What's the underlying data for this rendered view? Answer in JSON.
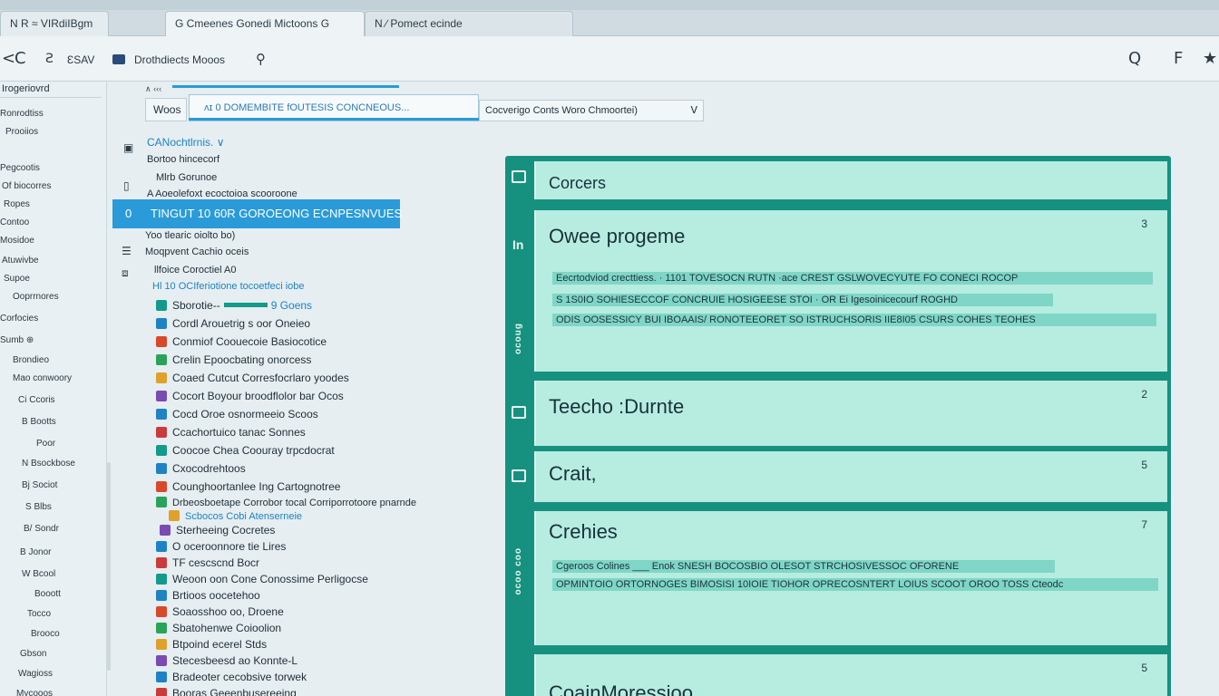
{
  "tabs": {
    "top_left": "N R  ≈  VIRdiIBgm",
    "tab1": "G   Cmeenes   Gonedi  Mictoons    G",
    "tab2": "N  ∕  Pomect ecinde"
  },
  "toolbar": {
    "back": "<",
    "reload": "C",
    "tools_label": "ƐSAV",
    "breadcrumb": "Drothdiects  Mooos",
    "search_icon": "Q",
    "f_icon": "F",
    "star_icon": "★"
  },
  "address": {
    "small_label": "∧ ‹‹‹",
    "word": "Woos",
    "input_value": "ᴧɪ 0 DOMEMBITE fOUTESIS CONCNEOUS...",
    "dropdown_value": "Cocverigo  Conts   Woro  Chmoortei)",
    "dropdown_chevron": "V"
  },
  "sidebar": {
    "top": "Irogeriovrd",
    "items": [
      "Ronrodtiss",
      "Prooiios",
      "Pegcootis",
      "Of biocorres",
      "Ropes",
      "Contoo",
      "Mosidoe",
      "Atuwivbe",
      "Supoe",
      "Ooprrnores",
      "Corfocies",
      "Sumb  ⊕",
      "Brondieo",
      "Mao conwoory",
      "Ci Ccoris",
      "B  Bootts",
      "Poor",
      "N  Bsockbose",
      "Bj  Sociot",
      "S  Blbs",
      "B/  Sondr",
      "B Jonor",
      "W  Bcool",
      "Booott",
      "Tocco",
      "Brooco",
      "Gbson",
      "Wagioss",
      "Mycooos"
    ]
  },
  "tree": {
    "header": "CANochtlrnis.   ∨",
    "rows": [
      "Bortoo hincecorf",
      "Mlrb Gorunoe",
      "A Aoeolefoxt ecoctoioa scooroone",
      "Yoo tlearic oiolto bo)",
      "Moqpvent Cachio oceis",
      "llfoice Coroctiel A0",
      "Hl 10  OCIferiotione tocoetfeci iobe",
      "Sborotie--",
      "Cordl  Arouetrig s oor Oneieo",
      "Conmiof Coouecoie Basiocotice",
      "Crelin Epoocbating onorcess",
      "Coaed Cutcut Corresfocrlaro yoodes",
      "Cocort Boyour broodflolor bar Ocos",
      "Cocd Oroe osnormeeio Scoos",
      "Ccachortuico tanac Sonnes",
      "Coocoe Chea Coouray trpcdocrat",
      "Cxocodrehtoos",
      "Counghoortanlee Ing Cartognotree",
      "Drbeosboetape Corrobor tocal Corriporrotoore pnarnde",
      "Scbocos Cobi Atenserneie",
      "Sterheeing Cocretes",
      "O oceroonnore tie Lires",
      "TF cescscnd Bocr",
      "Weoon oon Cone Conossime Perligocse",
      "Brtioos oocetehoo",
      "Soaosshoo oo, Droene",
      "Sbatohenwe Coioolion",
      "Btpoind ecerel Stds",
      "Stecesbeesd ao Konnte-L",
      "Bradeoter cecobsive torwek",
      "Booras Geeenbusereeing"
    ],
    "row_suffix_7": "9 Goens",
    "selected": "TINGUT  10  60R  GOROEONG  ECNPESNVUES",
    "selected_lead": "0"
  },
  "panel": {
    "rail_labels": [
      "ocoug",
      "ocoo coo"
    ],
    "cards": [
      {
        "title": "Corcers",
        "num": ""
      },
      {
        "title": "Owee progeme",
        "num": "3",
        "lines": [
          "Eecrtodviod  crecttiess.    ·   1101    TOVESOCN RUTN    ·ace   CREST GSLWOVECYUTE FO CONECI ROCOP",
          "S 1S0IO SOHIESECCOF CONCRUIE HOSIGEESE STOI   ·   OR Ei Igesoinicecourf ROGHD",
          "ODIS          OOSESSICY BUI IBOAAIS/ RONOTEEORET           SO ISTRUCHSORIS IIE8I05 CSURS COHES TEOHES"
        ]
      },
      {
        "title": "Teecho :Durnte",
        "num": "2"
      },
      {
        "title": "Crait,",
        "num": "5"
      },
      {
        "title": "Crehies",
        "num": "7",
        "lines": [
          "Cgeroos Colines ___ Enok        SNESH BOCOSBIO OLESOT STRCHOSIVESSOC OFORENE",
          "OPMINTOIO ORTORNOGES                        BIMOSISI  10IOIE TIOHOR  OPRECOSNTERT LOIUS SCOOT OROO TOSS Cteodc"
        ]
      },
      {
        "title": "CoainMoressioo",
        "num": "5"
      }
    ]
  },
  "colors": {
    "accent_blue": "#2a9bd8",
    "panel_teal": "#16917f",
    "card_mint": "#b7ece1",
    "line_teal": "#7fd6c7"
  }
}
